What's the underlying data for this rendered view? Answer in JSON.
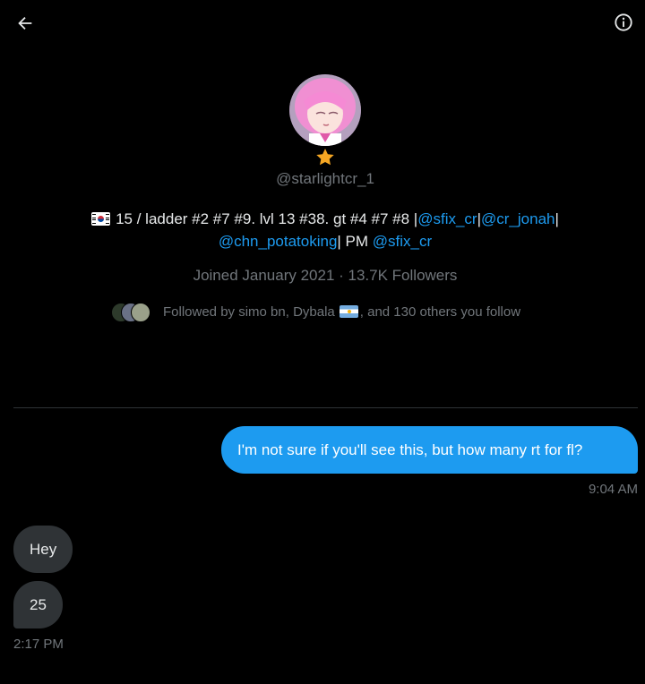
{
  "profile": {
    "handle": "@starlightcr_1",
    "bio": {
      "text1": "15 / ladder #2 #7 #9. lvl 13 #38. gt #4 #7 #8 |",
      "link1": "@sfix_cr",
      "sep1": "|",
      "link2": "@cr_jonah",
      "sep2": "|",
      "link3": "@chn_potatoking",
      "text2": "| PM ",
      "link4": "@sfix_cr"
    },
    "joined": "Joined January 2021 · 13.7K Followers",
    "followed_by_prefix": "Followed by simo bn, Dybala",
    "followed_by_suffix": ", and 130 others you follow"
  },
  "messages": {
    "outgoing": [
      {
        "text": "I'm not sure if you'll see this, but how many rt for fl?",
        "time": "9:04 AM"
      }
    ],
    "incoming": [
      {
        "text": "Hey"
      },
      {
        "text": "25"
      }
    ],
    "incoming_time": "2:17 PM"
  },
  "colors": {
    "accent": "#1d9bf0",
    "background": "#000000",
    "incoming_bubble": "#2f3336",
    "muted_text": "#71767b"
  },
  "icons": {
    "back": "arrow-left-icon",
    "info": "info-icon",
    "verified": "star-icon"
  }
}
